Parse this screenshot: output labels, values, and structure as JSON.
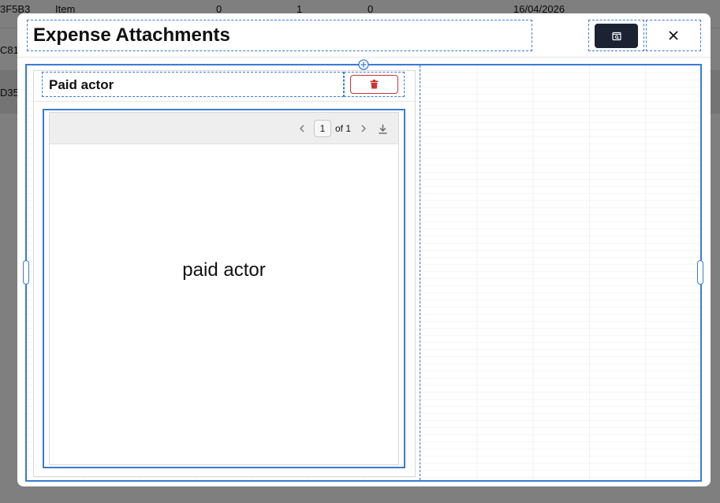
{
  "background_table": {
    "rows": [
      {
        "id": "3F5B3",
        "type": "Item",
        "c1": "0",
        "c2": "1",
        "c3": "0",
        "date": "16/04/2026"
      },
      {
        "id": "C81"
      },
      {
        "id": "D35"
      }
    ]
  },
  "modal": {
    "title": "Expense Attachments",
    "preview_icon": "document-search-icon",
    "close_icon": "close-icon"
  },
  "attachment": {
    "title": "Paid actor",
    "delete_icon": "trash-icon",
    "viewer": {
      "current_page": "1",
      "total_label": "of 1",
      "document_text": "paid actor"
    }
  },
  "colors": {
    "accent_blue": "#3b7bd6",
    "primary_dark": "#1b2333",
    "danger_red": "#c93636",
    "toolbar_gray": "#eeeeee"
  }
}
